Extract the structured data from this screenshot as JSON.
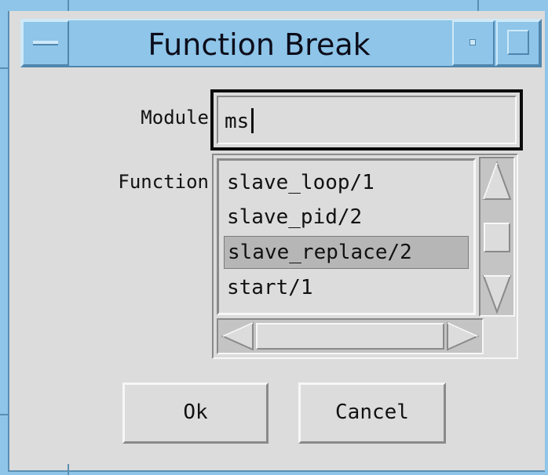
{
  "window": {
    "title": "Function Break",
    "menu_button": "window-menu",
    "minimize_button": "minimize",
    "maximize_button": "maximize"
  },
  "form": {
    "module_label": "Module",
    "module_value": "ms",
    "function_label": "Function"
  },
  "function_list": {
    "items": [
      "slave_loop/1",
      "slave_pid/2",
      "slave_replace/2",
      "start/1"
    ],
    "selected": "slave_replace/2"
  },
  "buttons": {
    "ok_label": "Ok",
    "cancel_label": "Cancel"
  },
  "colors": {
    "title_bar": "#8ec5e8",
    "dialog_bg": "#dcdcdc",
    "selection": "#b6b6b6"
  }
}
